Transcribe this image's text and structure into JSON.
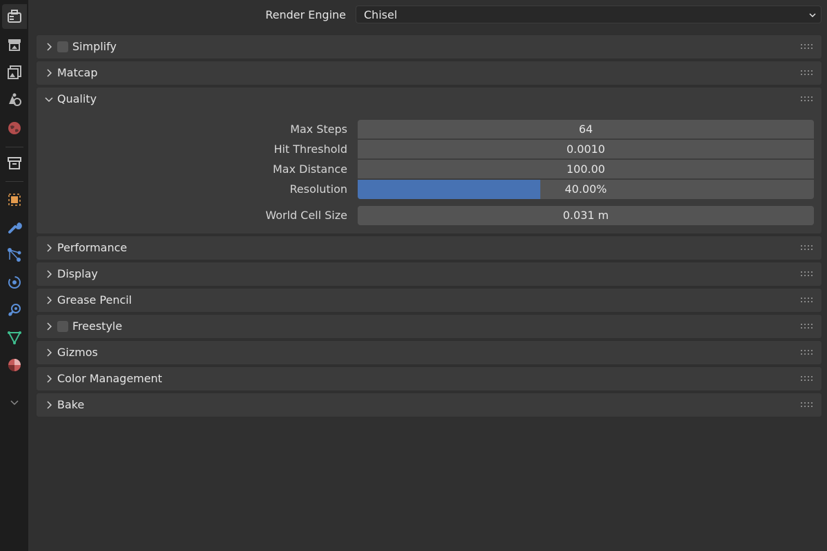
{
  "tabs": [
    {
      "name": "tool-icon"
    },
    {
      "name": "render-icon"
    },
    {
      "name": "output-icon"
    },
    {
      "name": "view-layer-icon"
    },
    {
      "name": "scene-icon"
    },
    {
      "name": "world-icon"
    },
    {
      "name": "collection-icon"
    },
    {
      "name": "object-icon"
    },
    {
      "name": "modifier-icon"
    },
    {
      "name": "particles-icon"
    },
    {
      "name": "physics-icon"
    },
    {
      "name": "constraints-icon"
    },
    {
      "name": "data-icon"
    },
    {
      "name": "material-icon"
    },
    {
      "name": "more-icon"
    }
  ],
  "render_engine": {
    "label": "Render Engine",
    "value": "Chisel"
  },
  "panels": {
    "simplify": {
      "title": "Simplify",
      "enabled": false
    },
    "matcap": {
      "title": "Matcap"
    },
    "quality": {
      "title": "Quality",
      "expanded": true,
      "max_steps": {
        "label": "Max Steps",
        "value": "64"
      },
      "hit_threshold": {
        "label": "Hit Threshold",
        "value": "0.0010"
      },
      "max_distance": {
        "label": "Max Distance",
        "value": "100.00"
      },
      "resolution": {
        "label": "Resolution",
        "value": "40.00%",
        "fraction": 0.4
      },
      "world_cell_size": {
        "label": "World Cell Size",
        "value": "0.031 m"
      }
    },
    "performance": {
      "title": "Performance"
    },
    "display": {
      "title": "Display"
    },
    "grease_pencil": {
      "title": "Grease Pencil"
    },
    "freestyle": {
      "title": "Freestyle",
      "enabled": false
    },
    "gizmos": {
      "title": "Gizmos"
    },
    "color_management": {
      "title": "Color Management"
    },
    "bake": {
      "title": "Bake"
    }
  },
  "colors": {
    "accent": "#4772b3",
    "panel": "#3b3b3b",
    "background": "#303030",
    "tab_strip": "#1d1d1d"
  }
}
